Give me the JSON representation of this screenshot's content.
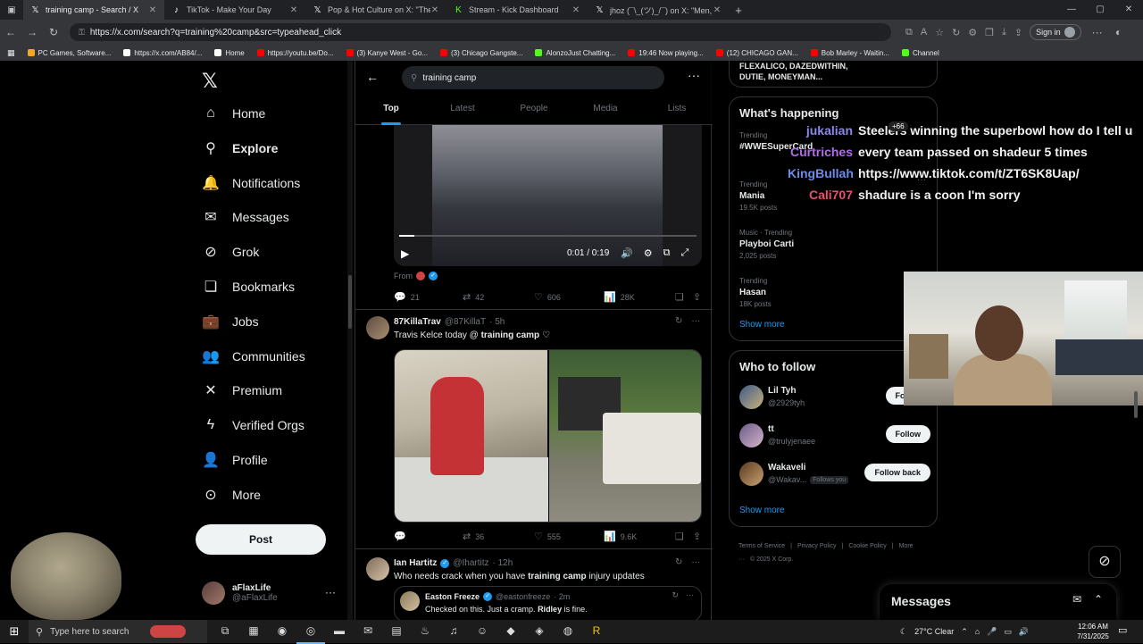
{
  "browser": {
    "tabs": [
      {
        "icon": "x-logo-icon",
        "title": "training camp - Search / X",
        "active": true
      },
      {
        "icon": "tiktok-icon",
        "title": "TikTok - Make Your Day",
        "active": false
      },
      {
        "icon": "x-logo-icon",
        "title": "Pop & Hot Culture on X: \"The be",
        "active": false
      },
      {
        "icon": "kick-icon",
        "title": "Stream - Kick Dashboard",
        "active": false
      },
      {
        "icon": "x-logo-icon",
        "title": "jhoz (¯\\_(ツ)_/¯) on X: \"Men, I challen",
        "active": false
      }
    ],
    "url": "https://x.com/search?q=training%20camp&src=typeahead_click",
    "signin_label": "Sign in",
    "bookmarks": [
      {
        "label": "PC Games, Software...",
        "color": "#f5a623"
      },
      {
        "label": "https://x.com/AB84/...",
        "color": "#ffffff"
      },
      {
        "label": "Home",
        "color": "#ffffff"
      },
      {
        "label": "https://youtu.be/Do...",
        "color": "#ff0000"
      },
      {
        "label": "(3) Kanye West - Go...",
        "color": "#ff0000"
      },
      {
        "label": "(3) Chicago Gangste...",
        "color": "#ff0000"
      },
      {
        "label": "AlonzoJust Chatting...",
        "color": "#53fc18"
      },
      {
        "label": "19:46 Now playing...",
        "color": "#ff0000"
      },
      {
        "label": "(12) CHICAGO GAN...",
        "color": "#ff0000"
      },
      {
        "label": "Bob Marley - Waitin...",
        "color": "#ff0000"
      },
      {
        "label": "Channel",
        "color": "#53fc18"
      }
    ]
  },
  "sidebar": {
    "items": [
      {
        "label": "Home",
        "icon": "home-icon",
        "glyph": "⌂"
      },
      {
        "label": "Explore",
        "icon": "search-icon",
        "glyph": "⚲"
      },
      {
        "label": "Notifications",
        "icon": "bell-icon",
        "glyph": "🔔"
      },
      {
        "label": "Messages",
        "icon": "envelope-icon",
        "glyph": "✉"
      },
      {
        "label": "Grok",
        "icon": "grok-icon",
        "glyph": "⊘"
      },
      {
        "label": "Bookmarks",
        "icon": "bookmark-icon",
        "glyph": "❏"
      },
      {
        "label": "Jobs",
        "icon": "briefcase-icon",
        "glyph": "💼"
      },
      {
        "label": "Communities",
        "icon": "people-icon",
        "glyph": "👥"
      },
      {
        "label": "Premium",
        "icon": "x-logo-icon",
        "glyph": "✕"
      },
      {
        "label": "Verified Orgs",
        "icon": "lightning-icon",
        "glyph": "ϟ"
      },
      {
        "label": "Profile",
        "icon": "person-icon",
        "glyph": "👤"
      },
      {
        "label": "More",
        "icon": "more-circle-icon",
        "glyph": "⊙"
      }
    ],
    "post_label": "Post",
    "account": {
      "name": "aFlaxLife",
      "handle": "@aFlaxLife"
    }
  },
  "search": {
    "query": "training camp",
    "tabs": [
      "Top",
      "Latest",
      "People",
      "Media",
      "Lists"
    ]
  },
  "feed": {
    "video_tweet": {
      "time": "0:01 / 0:19",
      "progress": 0.05,
      "from_label": "From",
      "replies": "21",
      "reposts": "42",
      "likes": "606",
      "views": "28K"
    },
    "tweet2": {
      "name": "87KillaTrav",
      "handle": "@87KillaT",
      "time": "· 5h",
      "text_before": "Travis Kelce today @ ",
      "text_bold": "training camp",
      "text_after": " ♡",
      "replies": "",
      "reposts": "36",
      "likes": "555",
      "views": "9.6K"
    },
    "tweet3": {
      "name": "Ian Hartitz",
      "handle": "@Ihartitz",
      "time": "· 12h",
      "text_before": "Who needs crack when you have ",
      "text_bold": "training camp",
      "text_after": " injury updates",
      "quote": {
        "name": "Easton Freeze",
        "handle": "@eastonfreeze",
        "time": "· 2m",
        "text_before": "Checked on this. Just a cramp. ",
        "text_bold": "Ridley",
        "text_after": " is fine."
      }
    }
  },
  "right": {
    "top_trend_lines": [
      "FLEXALICO, DAZEDWITHIN,",
      "DUTIE, MONEYMAN..."
    ],
    "happening_title": "What's happening",
    "trends": [
      {
        "category": "Trending",
        "name": "#WWESuperCard",
        "count": ""
      },
      {
        "category": "Trending",
        "name": "Mania",
        "count": "19.5K posts"
      },
      {
        "category": "Music · Trending",
        "name": "Playboi Carti",
        "count": "2,025 posts"
      },
      {
        "category": "Trending",
        "name": "Hasan",
        "count": "18K posts"
      }
    ],
    "show_more": "Show more",
    "who_title": "Who to follow",
    "follow": [
      {
        "name": "Lil Tyh",
        "handle": "@2929tyh",
        "btn": "Follow",
        "follows_you": ""
      },
      {
        "name": "tt",
        "handle": "@trulyjenaee",
        "btn": "Follow",
        "follows_you": ""
      },
      {
        "name": "Wakaveli",
        "handle": "@Wakav...",
        "btn": "Follow back",
        "follows_you": "Follows you"
      }
    ],
    "footer": [
      "Terms of Service",
      "|",
      "Privacy Policy",
      "|",
      "Cookie Policy",
      "|",
      "More ···",
      "© 2025 X Corp."
    ]
  },
  "messages_drawer": {
    "title": "Messages"
  },
  "stream_chat": {
    "badge": "+66",
    "lines": [
      {
        "user": "jukalian",
        "color": "#8a8ae6",
        "msg": "Steelers winning the superbowl how do I tell u"
      },
      {
        "user": "Curtriches",
        "color": "#b06ee6",
        "msg": "every team passed on shadeur 5 times"
      },
      {
        "user": "KingBullah",
        "color": "#6e8be6",
        "msg": "https://www.tiktok.com/t/ZT6SK8Uap/"
      },
      {
        "user": "Cali707",
        "color": "#e6536e",
        "msg": "shadure is a coon I'm sorry"
      }
    ]
  },
  "taskbar": {
    "search_placeholder": "Type here to search",
    "weather": "27°C  Clear",
    "time": "12:06 AM",
    "date": "7/31/2025"
  }
}
